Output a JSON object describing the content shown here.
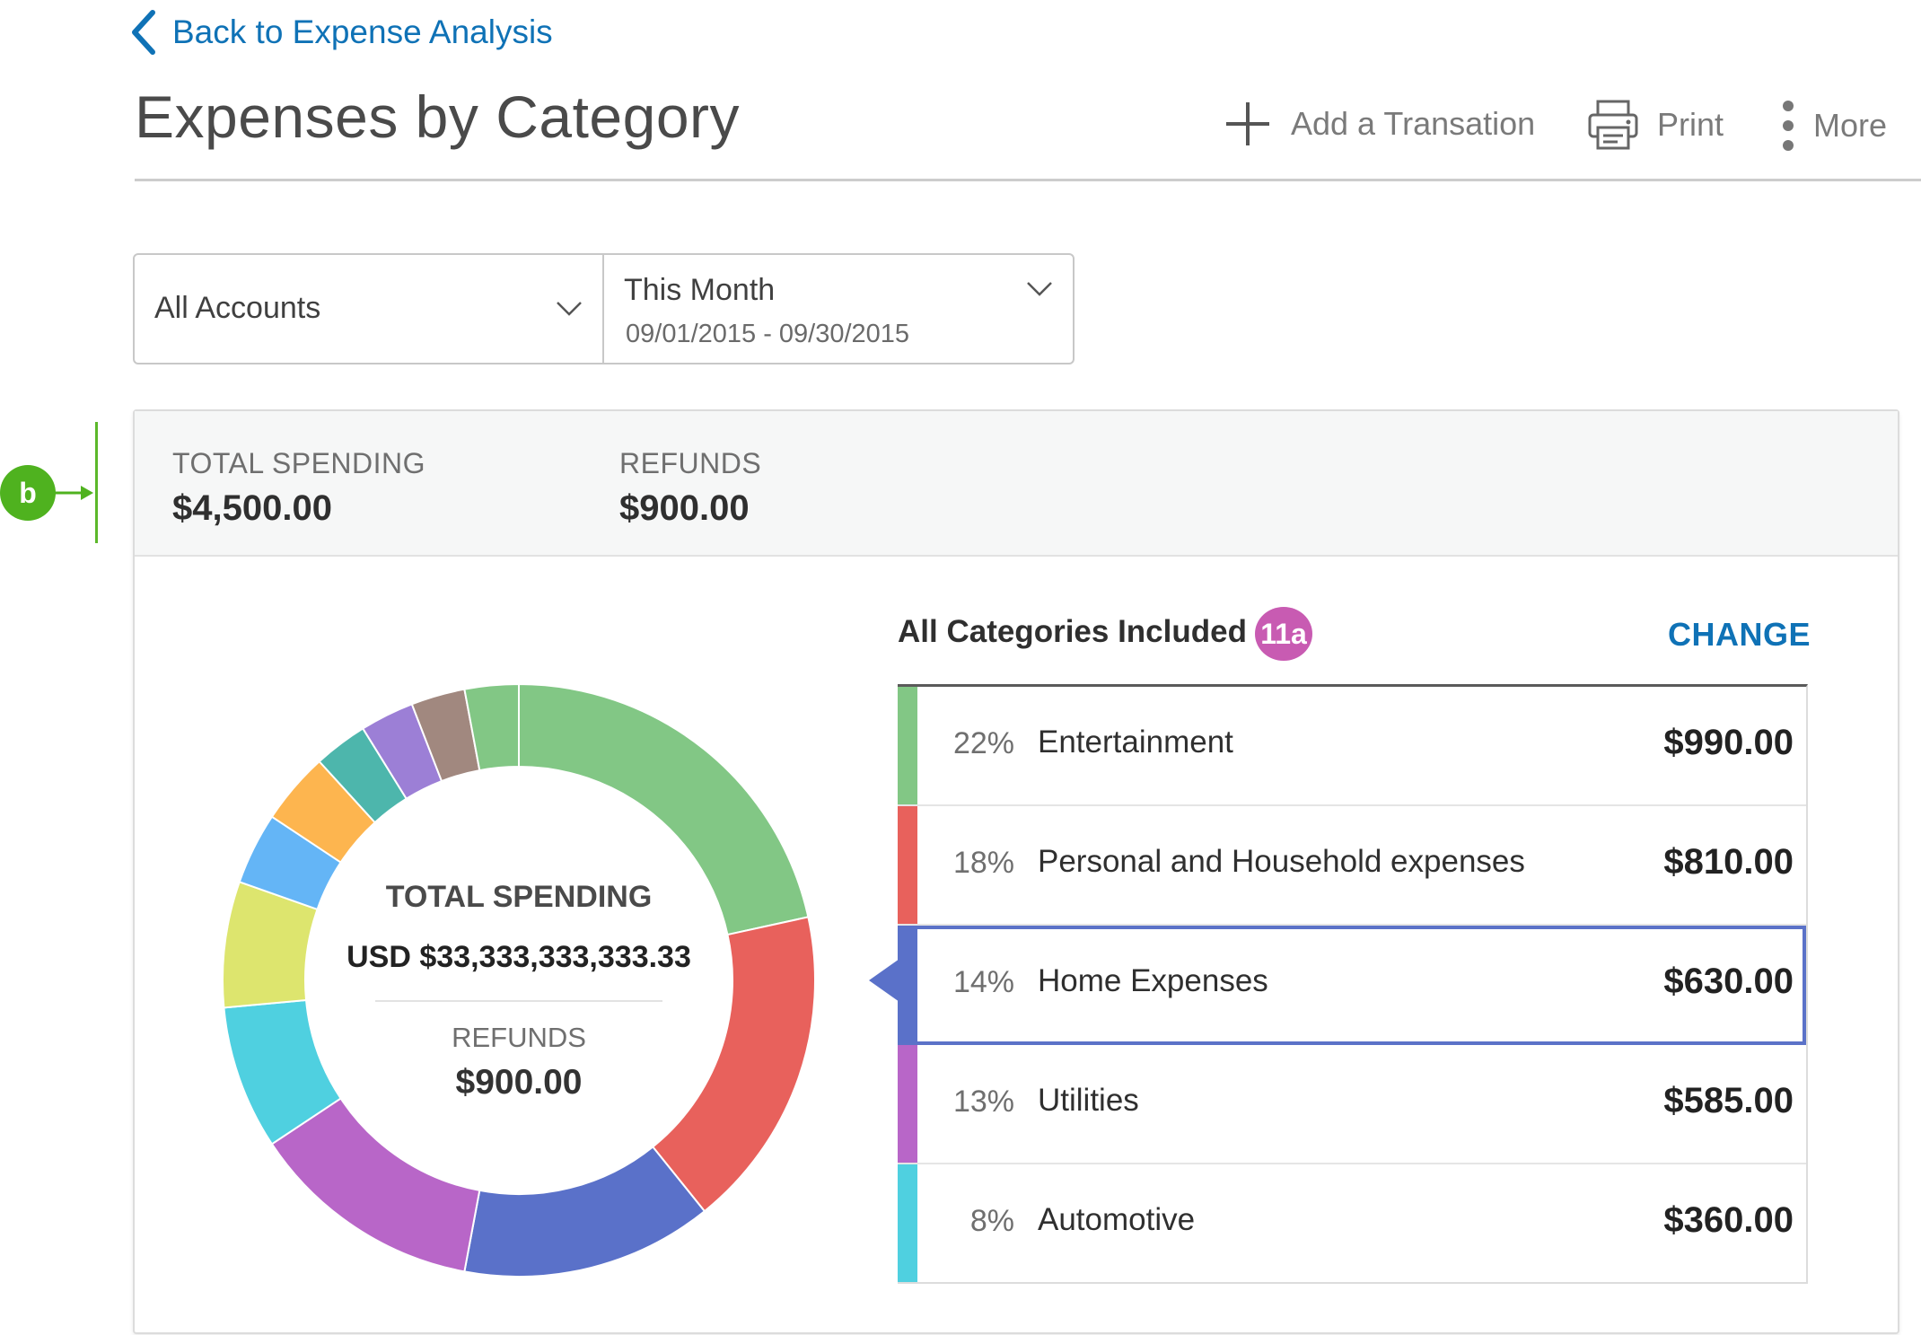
{
  "header": {
    "back_label": "Back to Expense Analysis",
    "title": "Expenses by Category",
    "actions": {
      "add": "Add a Transation",
      "print": "Print",
      "more": "More"
    }
  },
  "filters": {
    "accounts": {
      "label": "All Accounts"
    },
    "period": {
      "label": "This Month",
      "range": "09/01/2015 - 09/30/2015"
    }
  },
  "annotations": {
    "b": "b",
    "badge": "11a"
  },
  "summary": {
    "total_label": "TOTAL SPENDING",
    "total_value": "$4,500.00",
    "refunds_label": "REFUNDS",
    "refunds_value": "$900.00"
  },
  "donut_center": {
    "total_label": "TOTAL SPENDING",
    "total_value": "USD $33,333,333,333.33",
    "refunds_label": "REFUNDS",
    "refunds_value": "$900.00"
  },
  "categories_panel": {
    "title": "All Categories Included",
    "change_label": "CHANGE",
    "rows": [
      {
        "pct": "22%",
        "name": "Entertainment",
        "amount": "$990.00",
        "color": "#82c785"
      },
      {
        "pct": "18%",
        "name": "Personal and Household expenses",
        "amount": "$810.00",
        "color": "#e8615c"
      },
      {
        "pct": "14%",
        "name": "Home Expenses",
        "amount": "$630.00",
        "color": "#5a71c9",
        "selected": true
      },
      {
        "pct": "13%",
        "name": "Utilities",
        "amount": "$585.00",
        "color": "#b866c8"
      },
      {
        "pct": "8%",
        "name": "Automotive",
        "amount": "$360.00",
        "color": "#4fd0e0"
      }
    ]
  },
  "chart_data": {
    "type": "pie",
    "categories": [
      "Entertainment",
      "Personal and Household expenses",
      "Home Expenses",
      "Utilities",
      "Automotive",
      "",
      "",
      "",
      "",
      "",
      "",
      ""
    ],
    "values": [
      22,
      18,
      14,
      13,
      8,
      7,
      4,
      4,
      3,
      3,
      3,
      3
    ],
    "colors": [
      "#82c785",
      "#e8615c",
      "#5a71c9",
      "#b866c8",
      "#4fd0e0",
      "#dde56e",
      "#64b5f6",
      "#fdb54f",
      "#4db6ac",
      "#9c7fd6",
      "#a1887f",
      "#82c785"
    ],
    "start_angle_deg": -90
  }
}
